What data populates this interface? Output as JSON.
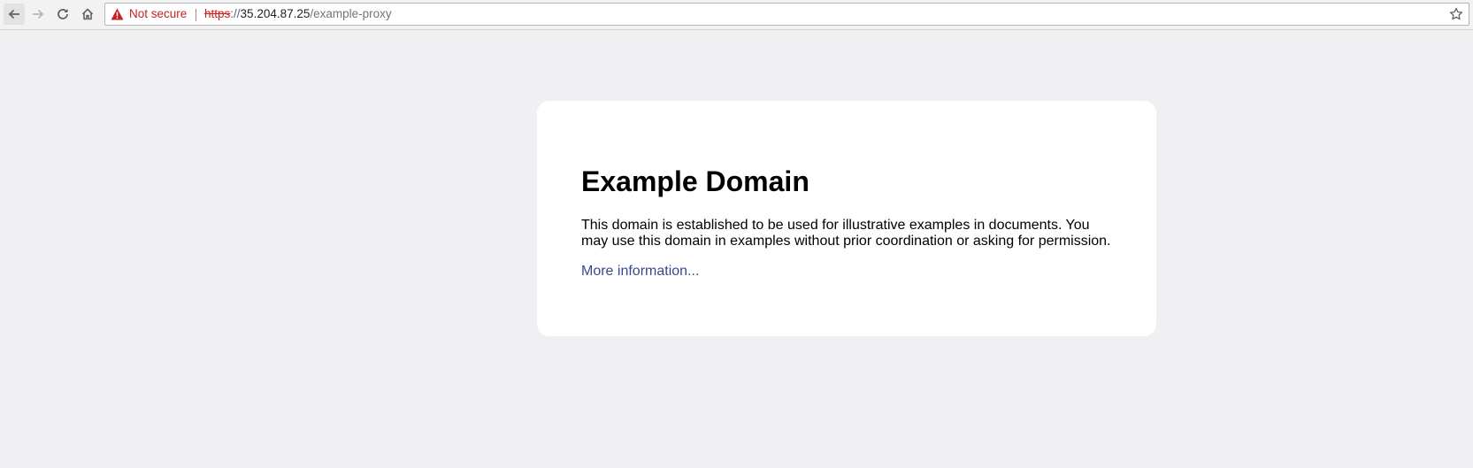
{
  "browser": {
    "security_label": "Not secure",
    "url": {
      "scheme": "https",
      "separator": "://",
      "host": "35.204.87.25",
      "path": "/example-proxy"
    },
    "icons": {
      "back": "back-arrow-icon",
      "forward": "forward-arrow-icon",
      "reload": "reload-icon",
      "home": "home-icon",
      "warning": "warning-triangle-icon",
      "bookmark": "star-icon"
    }
  },
  "page": {
    "heading": "Example Domain",
    "description": "This domain is established to be used for illustrative examples in documents. You may use this domain in examples without prior coordination or asking for permission.",
    "link_text": "More information...",
    "colors": {
      "background": "#f0f0f2",
      "card": "#ffffff",
      "link": "#38488f",
      "warning": "#c5221f"
    }
  }
}
